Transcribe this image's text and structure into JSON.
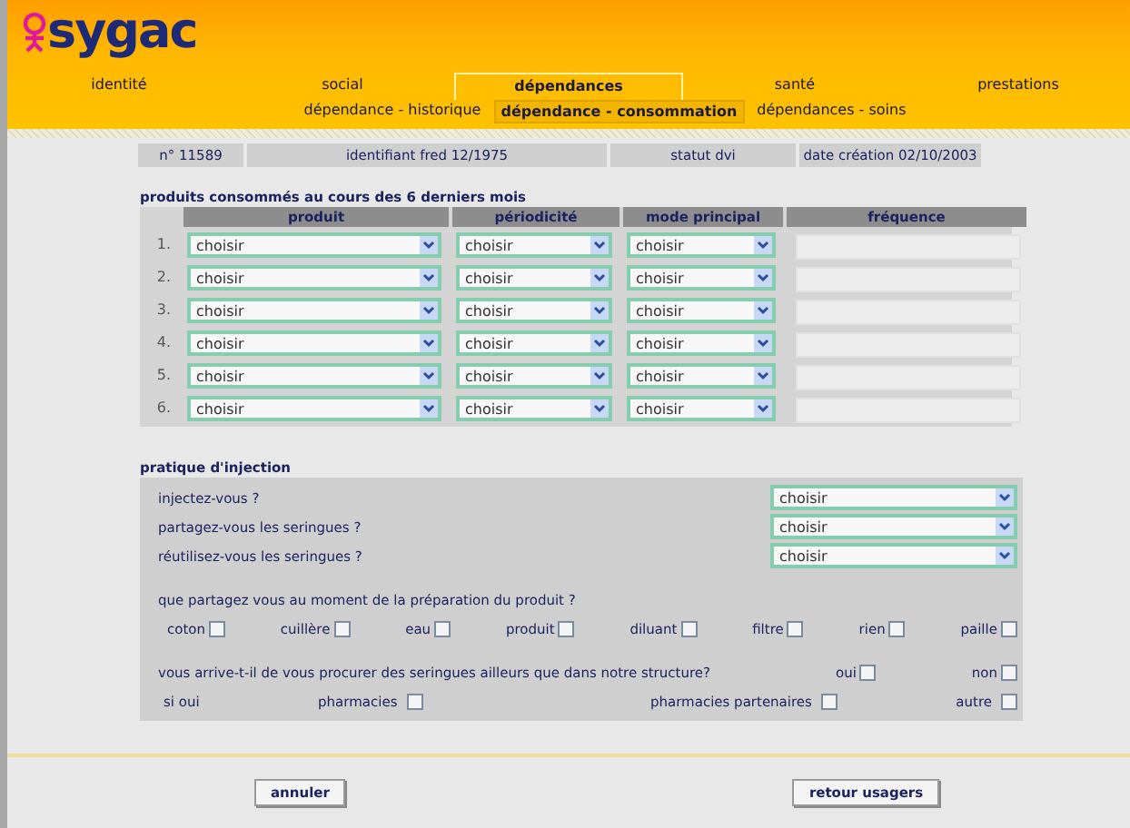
{
  "logo": {
    "text": "sygac"
  },
  "tabs": [
    {
      "label": "identité",
      "selected": false
    },
    {
      "label": "social",
      "selected": false
    },
    {
      "label": "dépendances",
      "selected": true
    },
    {
      "label": "santé",
      "selected": false
    },
    {
      "label": "prestations",
      "selected": false
    }
  ],
  "subtabs": [
    {
      "label": "dépendance - historique",
      "selected": false
    },
    {
      "label": "dépendance - consommation",
      "selected": true
    },
    {
      "label": "dépendances - soins",
      "selected": false
    }
  ],
  "info": [
    "n° 11589",
    "identifiant fred 12/1975",
    "statut dvi",
    "date création 02/10/2003"
  ],
  "products": {
    "title": "produits consommés au cours des 6 derniers mois",
    "columns": [
      "produit",
      "périodicité",
      "mode principal",
      "fréquence"
    ],
    "rows": [
      {
        "number": "1.",
        "selects": [
          "choisir",
          "choisir",
          "choisir"
        ]
      },
      {
        "number": "2.",
        "selects": [
          "choisir",
          "choisir",
          "choisir"
        ]
      },
      {
        "number": "3.",
        "selects": [
          "choisir",
          "choisir",
          "choisir"
        ]
      },
      {
        "number": "4.",
        "selects": [
          "choisir",
          "choisir",
          "choisir"
        ]
      },
      {
        "number": "5.",
        "selects": [
          "choisir",
          "choisir",
          "choisir"
        ]
      },
      {
        "number": "6.",
        "selects": [
          "choisir",
          "choisir",
          "choisir"
        ]
      }
    ]
  },
  "injection": {
    "title": "pratique d'injection",
    "questions": [
      {
        "label": "injectez-vous ?",
        "value": "choisir"
      },
      {
        "label": "partagez-vous les seringues ?",
        "value": "choisir"
      },
      {
        "label": "réutilisez-vous les seringues ?",
        "value": "choisir"
      }
    ],
    "shared_question": "que partagez vous au moment de la préparation du produit ?",
    "shared_items": [
      {
        "label": "coton",
        "checked": false
      },
      {
        "label": "cuillère",
        "checked": false
      },
      {
        "label": "eau",
        "checked": false
      },
      {
        "label": "produit",
        "checked": false
      },
      {
        "label": "diluant",
        "checked": false
      },
      {
        "label": "filtre",
        "checked": false
      },
      {
        "label": "rien",
        "checked": false
      },
      {
        "label": "paille",
        "checked": false
      }
    ],
    "elsewhere_question": "vous arrive-t-il de vous procurer des seringues ailleurs que dans notre structure?",
    "elsewhere_options": [
      {
        "label": "oui",
        "checked": false
      },
      {
        "label": "non",
        "checked": false
      }
    ],
    "if_yes": "si oui",
    "if_yes_options": [
      {
        "label": "pharmacies",
        "checked": false
      },
      {
        "label": "pharmacies partenaires",
        "checked": false
      },
      {
        "label": "autre",
        "checked": false
      }
    ]
  },
  "buttons": [
    "annuler",
    "retour usagers"
  ]
}
